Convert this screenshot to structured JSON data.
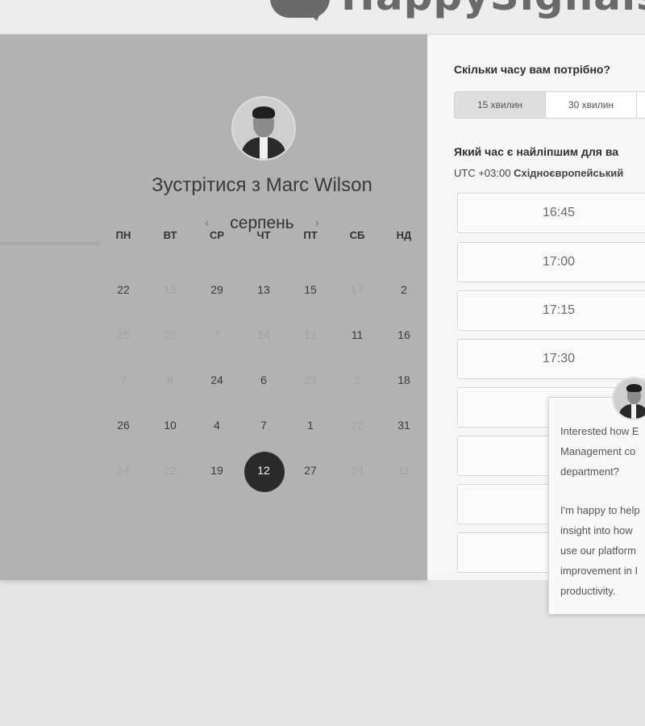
{
  "brand": {
    "name": "HappySignals"
  },
  "meeting": {
    "title": "Зустрітися з Marc Wilson",
    "month": "серпень",
    "prev_arrow": "‹",
    "next_arrow": "›"
  },
  "calendar": {
    "weekdays": [
      "ПН",
      "ВТ",
      "СР",
      "ЧТ",
      "ПТ",
      "СБ",
      "НД"
    ],
    "weeks": [
      [
        "22",
        "19",
        "29",
        "13",
        "15",
        "17",
        "2"
      ],
      [
        "25",
        "25",
        "7",
        "14",
        "12",
        "11",
        "16"
      ],
      [
        "7",
        "6",
        "24",
        "6",
        "23",
        "2",
        "18"
      ],
      [
        "26",
        "10",
        "4",
        "7",
        "1",
        "22",
        "31"
      ],
      [
        "24",
        "22",
        "19",
        "12",
        "27",
        "24",
        "11"
      ]
    ],
    "selected": "12"
  },
  "booking": {
    "duration_question": "Скільки часу вам потрібно?",
    "durations": [
      "15 хвилин",
      "30 хвилин"
    ],
    "time_question": "Який час є найліпшим для ва",
    "timezone_prefix": "UTC +03:00",
    "timezone_name": "Східноєвропейський",
    "slots": [
      "16:45",
      "17:00",
      "17:15",
      "17:30",
      "",
      "",
      "",
      ""
    ]
  },
  "popup": {
    "line1": "Interested how E",
    "line2": "Management co",
    "line3": "department?",
    "line4": "I'm happy to help",
    "line5": "insight into how",
    "line6": "use our platform",
    "line7": "improvement in I",
    "line8": "productivity."
  },
  "icons": {
    "prev": "chevron-left-icon",
    "next": "chevron-right-icon"
  }
}
